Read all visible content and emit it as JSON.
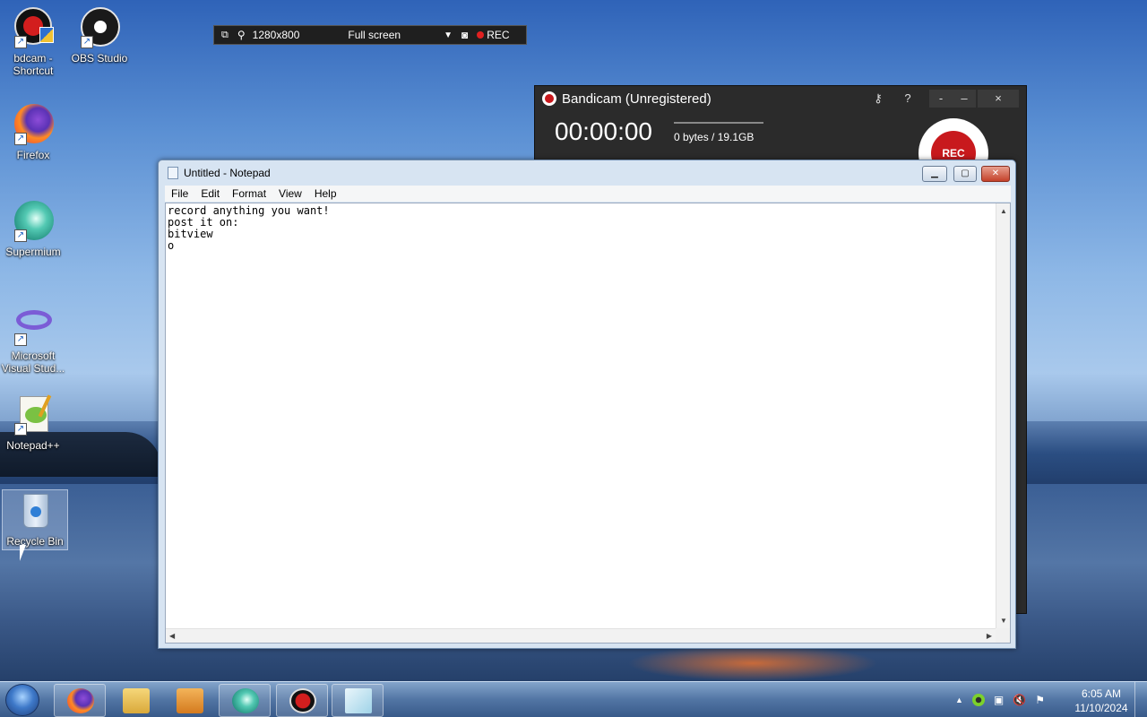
{
  "desktop": {
    "icons": [
      {
        "label": "bdcam - Shortcut",
        "icon": "bandicam-icon"
      },
      {
        "label": "OBS Studio",
        "icon": "obs-icon"
      },
      {
        "label": "Firefox",
        "icon": "firefox-icon"
      },
      {
        "label": "Supermium",
        "icon": "supermium-icon"
      },
      {
        "label": "Microsoft Visual Stud...",
        "icon": "visual-studio-icon"
      },
      {
        "label": "Notepad++",
        "icon": "notepadpp-icon"
      },
      {
        "label": "Recycle Bin",
        "icon": "recycle-bin-icon"
      }
    ]
  },
  "bandicam_toolbar": {
    "resolution": "1280x800",
    "mode": "Full screen",
    "rec_label": "REC"
  },
  "bandicam_window": {
    "title": "Bandicam (Unregistered)",
    "timer": "00:00:00",
    "size": "0 bytes / 19.1GB",
    "rec_button": "REC",
    "help": "?",
    "minimize": "-",
    "maximize": "–",
    "close": "×"
  },
  "notepad": {
    "title": "Untitled - Notepad",
    "menu": [
      "File",
      "Edit",
      "Format",
      "View",
      "Help"
    ],
    "content": "record anything you want!\npost it on:\nbitview\no"
  },
  "taskbar": {
    "apps": [
      "firefox-icon",
      "explorer-icon",
      "media-player-icon",
      "supermium-icon",
      "bandicam-icon",
      "notepad-icon"
    ],
    "time": "6:05 AM",
    "date": "11/10/2024"
  }
}
